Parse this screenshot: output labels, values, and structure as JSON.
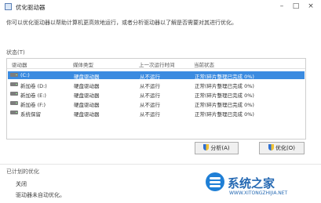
{
  "window": {
    "title": "优化驱动器"
  },
  "description": "你可以优化驱动器以帮助计算机更高效地运行，或者分析驱动器以了解是否需要对其进行优化。",
  "status_section": {
    "label": "状态(T)"
  },
  "table": {
    "headers": [
      "驱动器",
      "媒体类型",
      "上一次运行时间",
      "当前状态"
    ],
    "rows": [
      {
        "drive": "(C:)",
        "media": "硬盘驱动器",
        "last_run": "从不运行",
        "status": "正常(碎片整理已完成 0%)",
        "selected": true
      },
      {
        "drive": "新加卷 (D:)",
        "media": "硬盘驱动器",
        "last_run": "从不运行",
        "status": "正常(碎片整理已完成 0%)",
        "selected": false
      },
      {
        "drive": "新加卷 (E:)",
        "media": "硬盘驱动器",
        "last_run": "从不运行",
        "status": "正常(碎片整理已完成 0%)",
        "selected": false
      },
      {
        "drive": "新加卷 (F:)",
        "media": "硬盘驱动器",
        "last_run": "从不运行",
        "status": "正常(碎片整理已完成 0%)",
        "selected": false
      },
      {
        "drive": "系统保留",
        "media": "硬盘驱动器",
        "last_run": "从不运行",
        "status": "正常(碎片整理已完成 0%)",
        "selected": false
      }
    ]
  },
  "buttons": {
    "analyze": "分析(A)",
    "optimize": "优化(O)"
  },
  "scheduled": {
    "label": "已计划的优化",
    "state": "关闭",
    "detail": "驱动器未自动优化。"
  },
  "watermark": {
    "text": "系统之家",
    "url": "WWW.XITONGZHIJIA.NET"
  }
}
